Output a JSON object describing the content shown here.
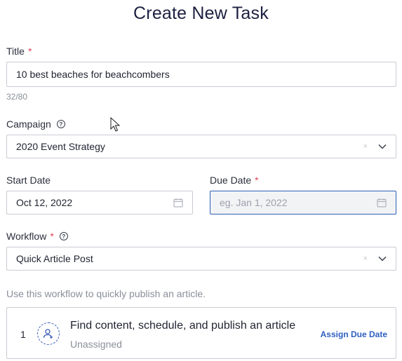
{
  "page": {
    "title": "Create New Task"
  },
  "title_field": {
    "label": "Title",
    "required_mark": "*",
    "value": "10 best beaches for beachcombers",
    "counter": "32/80"
  },
  "campaign": {
    "label": "Campaign",
    "help_glyph": "?",
    "value": "2020 Event Strategy",
    "clear_glyph": "×"
  },
  "start_date": {
    "label": "Start Date",
    "value": "Oct 12, 2022"
  },
  "due_date": {
    "label": "Due Date",
    "required_mark": "*",
    "placeholder": "eg. Jan 1, 2022"
  },
  "workflow": {
    "label": "Workflow",
    "required_mark": "*",
    "help_glyph": "?",
    "value": "Quick Article Post",
    "clear_glyph": "×",
    "hint": "Use this workflow to quickly publish an article."
  },
  "steps": [
    {
      "number": "1",
      "title": "Find content, schedule, and publish an article",
      "assignee": "Unassigned",
      "action": "Assign Due Date"
    }
  ],
  "colors": {
    "accent": "#2e5fc0",
    "required": "#e0485a",
    "focus_border": "#2f5fb8",
    "heading": "#1c2040"
  }
}
